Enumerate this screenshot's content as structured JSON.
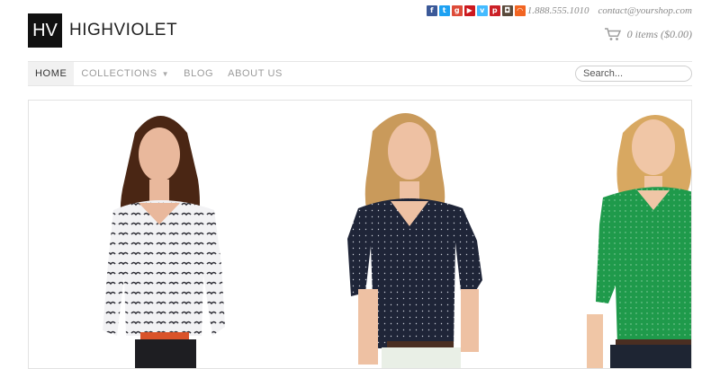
{
  "logo": {
    "mark": "HV",
    "name": "HIGHVIOLET"
  },
  "social": [
    {
      "icon": "facebook-icon",
      "glyph": "f",
      "color": "#3b5998"
    },
    {
      "icon": "twitter-icon",
      "glyph": "t",
      "color": "#1da1f2"
    },
    {
      "icon": "google-plus-icon",
      "glyph": "g",
      "color": "#dd4b39"
    },
    {
      "icon": "youtube-icon",
      "glyph": "▶",
      "color": "#cc181e"
    },
    {
      "icon": "vimeo-icon",
      "glyph": "v",
      "color": "#44bbff"
    },
    {
      "icon": "pinterest-icon",
      "glyph": "p",
      "color": "#cb2027"
    },
    {
      "icon": "instagram-icon",
      "glyph": "◘",
      "color": "#5a4a3b"
    },
    {
      "icon": "rss-icon",
      "glyph": "◠",
      "color": "#f26522"
    }
  ],
  "contact": {
    "phone": "1.888.555.1010",
    "email": "contact@yourshop.com"
  },
  "cart": {
    "label": "0 items ($0.00)"
  },
  "nav": {
    "items": [
      {
        "label": "HOME",
        "active": true
      },
      {
        "label": "COLLECTIONS",
        "dropdown": true
      },
      {
        "label": "BLOG"
      },
      {
        "label": "ABOUT US"
      }
    ],
    "search_placeholder": "Search..."
  },
  "slider": {
    "slides": [
      {
        "shirt": "#f2f2f4",
        "pattern": "#2b2b33",
        "pants": "#1e1e22",
        "belt": "#d9532a",
        "hair": "#4a2614",
        "skin": "#e9b89c"
      },
      {
        "shirt": "#1f2538",
        "pattern": "#c9ccd6",
        "pants": "#e9efe6",
        "belt": "#4a2e22",
        "hair": "#c99a5b",
        "skin": "#eec1a3"
      },
      {
        "shirt": "#1f9a4b",
        "pattern": "#8fd3a6",
        "pants": "#1e2533",
        "belt": "#4a2e22",
        "hair": "#d8a861",
        "skin": "#f0c6a6"
      }
    ]
  }
}
